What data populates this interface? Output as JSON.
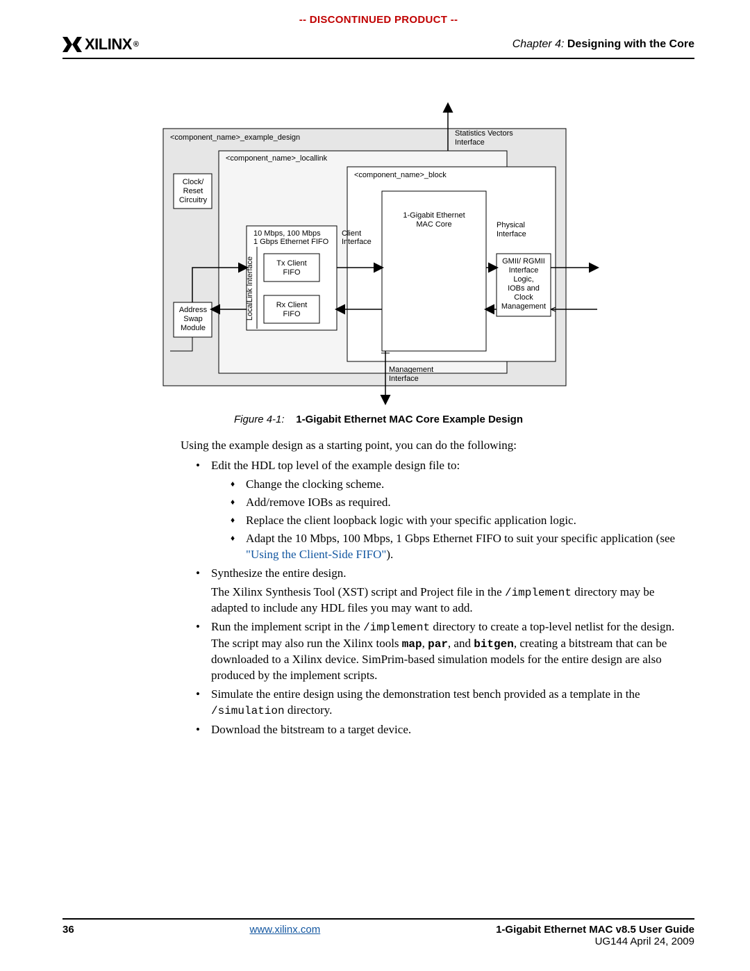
{
  "banner": "-- DISCONTINUED PRODUCT --",
  "logo_text": "XILINX",
  "logo_reg": "®",
  "chapter_label": "Chapter 4:",
  "chapter_title": "Designing with the Core",
  "figure": {
    "example_design": "<component_name>_example_design",
    "locallink": "<component_name>_locallink",
    "block": "<component_name>_block",
    "clock_l1": "Clock/",
    "clock_l2": "Reset",
    "clock_l3": "Circuitry",
    "fifo_grp_l1": "10 Mbps, 100 Mbps",
    "fifo_grp_l2": "1 Gbps Ethernet FIFO",
    "client_if_l1": "Client",
    "client_if_l2": "Interface",
    "tx_l1": "Tx Client",
    "tx_l2": "FIFO",
    "rx_l1": "Rx Client",
    "rx_l2": "FIFO",
    "llink": "LocalLink Interface",
    "addr_l1": "Address",
    "addr_l2": "Swap",
    "addr_l3": "Module",
    "mac_l1": "1-Gigabit Ethernet",
    "mac_l2": "MAC Core",
    "phy_l1": "Physical",
    "phy_l2": "Interface",
    "gmii_l1": "GMII/ RGMII",
    "gmii_l2": "Interface",
    "gmii_l3": "Logic,",
    "gmii_l4": "IOBs and",
    "gmii_l5": "Clock",
    "gmii_l6": "Management",
    "stats_l1": "Statistics Vectors",
    "stats_l2": "Interface",
    "mgmt_l1": "Management",
    "mgmt_l2": "Interface",
    "caption_label": "Figure 4-1:",
    "caption_title": "1-Gigabit Ethernet MAC Core Example Design"
  },
  "intro": "Using the example design as a starting point, you can do the following:",
  "b1": "Edit the HDL top level of the example design file to:",
  "b1a": "Change the clocking scheme.",
  "b1b": "Add/remove IOBs as required.",
  "b1c": "Replace the client loopback logic with your specific application logic.",
  "b1d_pre": "Adapt the 10 Mbps, 100 Mbps, 1 Gbps Ethernet FIFO to suit your specific application (see ",
  "b1d_link": "\"Using the Client-Side FIFO\"",
  "b1d_post": ").",
  "b2": "Synthesize the entire design.",
  "b2_p_pre": "The Xilinx Synthesis Tool (XST) script and Project file in the ",
  "b2_p_code": "/implement",
  "b2_p_post": " directory may be adapted to include any HDL files you may want to add.",
  "b3_pre": "Run the implement script in the ",
  "b3_code": "/implement",
  "b3_mid": " directory to create a top-level netlist for the design. The script may also run the Xilinx tools ",
  "b3_map": "map",
  "b3_c1": ", ",
  "b3_par": "par",
  "b3_c2": ", and ",
  "b3_bitgen": "bitgen",
  "b3_post": ", creating a bitstream that can be downloaded to a Xilinx device. SimPrim-based simulation models for the entire design are also produced by the implement scripts.",
  "b4_pre": "Simulate the entire design using the demonstration test bench provided as a template in the ",
  "b4_code": "/simulation",
  "b4_post": " directory.",
  "b5": "Download the bitstream to a target device.",
  "footer": {
    "page": "36",
    "url": "www.xilinx.com",
    "title": "1-Gigabit Ethernet MAC v8.5 User Guide",
    "docid": "UG144 April 24, 2009"
  }
}
